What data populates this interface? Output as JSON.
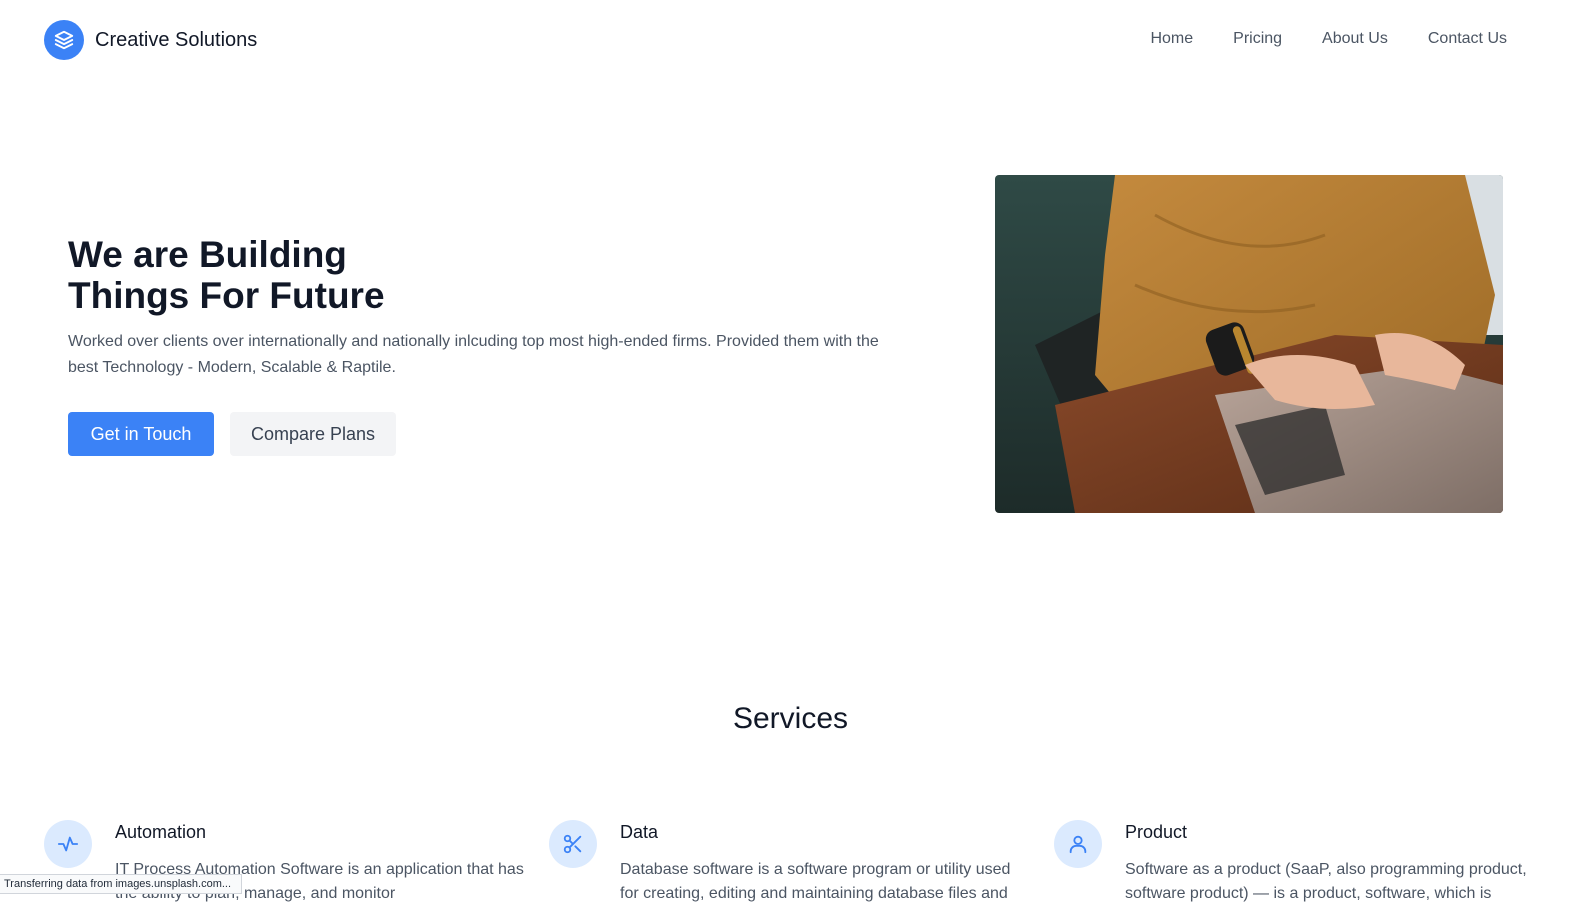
{
  "brand": {
    "name": "Creative Solutions",
    "icon": "layers-icon",
    "accent_color": "#3b82f6"
  },
  "nav": {
    "items": [
      {
        "label": "Home"
      },
      {
        "label": "Pricing"
      },
      {
        "label": "About Us"
      },
      {
        "label": "Contact Us"
      }
    ]
  },
  "hero": {
    "title_line1": "We are Building",
    "title_line2": "Things For Future",
    "description": "Worked over clients over internationally and nationally inlcuding top most high-ended firms. Provided them with the best Technology - Modern, Scalable & Raptile.",
    "primary_button": "Get in Touch",
    "secondary_button": "Compare Plans",
    "image_subject": "person typing on a laptop on a wooden desk"
  },
  "services": {
    "title": "Services",
    "items": [
      {
        "icon": "activity-icon",
        "title": "Automation",
        "description": "IT Process Automation Software is an application that has the ability to plan, manage, and monitor"
      },
      {
        "icon": "scissors-icon",
        "title": "Data",
        "description": "Database software is a software program or utility used for creating, editing and maintaining database files and"
      },
      {
        "icon": "user-icon",
        "title": "Product",
        "description": "Software as a product (SaaP, also programming product, software product) — is a product, software, which is"
      }
    ]
  },
  "status_bar": {
    "text": "Transferring data from images.unsplash.com..."
  }
}
